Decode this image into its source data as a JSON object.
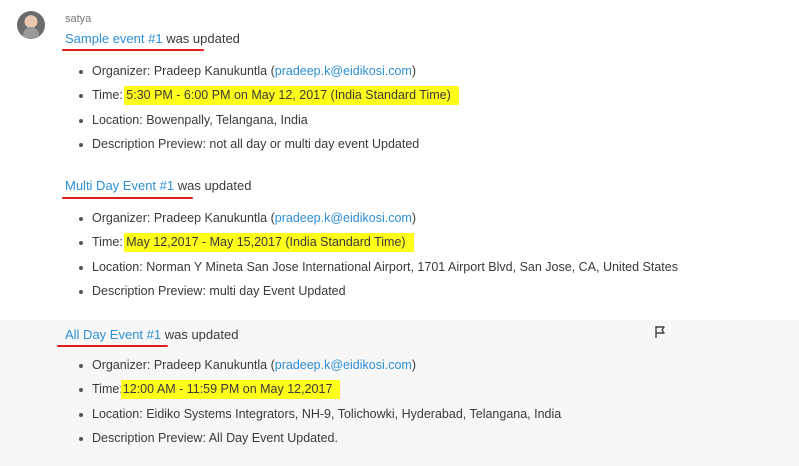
{
  "user": {
    "name": "satya"
  },
  "events": [
    {
      "link": "Sample event #1",
      "suffix": " was updated",
      "organizer_label": "Organizer: Pradeep Kanukuntla (",
      "organizer_email": "pradeep.k@eidikosi.com",
      "organizer_close": ")",
      "time_label": "Time: ",
      "time_value": "5:30 PM - 6:00 PM on May 12, 2017 (India Standard Time)",
      "location": "Location:   Bowenpally,  Telangana,  India",
      "description": "Description Preview:  not all day or multi day event Updated"
    },
    {
      "link": "Multi Day Event #1",
      "suffix": " was updated",
      "organizer_label": "Organizer: Pradeep Kanukuntla (",
      "organizer_email": "pradeep.k@eidikosi.com",
      "organizer_close": ")",
      "time_label": "Time: ",
      "time_value": "May 12,2017 - May 15,2017 (India Standard Time)",
      "location": "Location: Norman Y Mineta San Jose International Airport,    1701 Airport Blvd,  San Jose,  CA,  United States",
      "description": "Description Preview:  multi day Event Updated"
    },
    {
      "link": "All Day Event #1",
      "suffix": " was updated",
      "organizer_label": "Organizer: Pradeep Kanukuntla (",
      "organizer_email": "pradeep.k@eidikosi.com",
      "organizer_close": ")",
      "time_label": "Time:",
      "time_value": "12:00 AM - 11:59 PM on May 12,2017",
      "location": "Location: Eidiko Systems Integrators,    NH-9,  Tolichowki,  Hyderabad,  Telangana,  India",
      "description": "Description Preview:  All Day Event Updated."
    }
  ],
  "colors": {
    "link": "#2d8fd5",
    "highlight": "#ffff1a",
    "annotation": "#e02020"
  }
}
